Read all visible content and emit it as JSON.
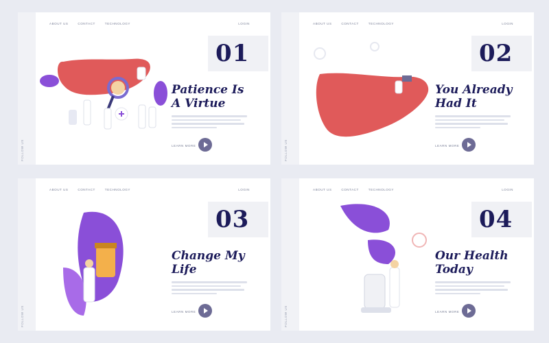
{
  "cards": [
    {
      "number": "01",
      "title_line1": "Patience Is",
      "title_line2": "A Virtue"
    },
    {
      "number": "02",
      "title_line1": "You Already",
      "title_line2": "Had It"
    },
    {
      "number": "03",
      "title_line1": "Change My",
      "title_line2": "Life"
    },
    {
      "number": "04",
      "title_line1": "Our Health",
      "title_line2": "Today"
    }
  ],
  "nav": {
    "about": "ABOUT US",
    "contact": "CONTACT",
    "technology": "TECHNOLOGY",
    "login": "LOGIN"
  },
  "follow_us": "FOLLOW US",
  "learn_more": "LEARN MORE",
  "colors": {
    "navy": "#1c1b5a",
    "liver": "#e05a5a",
    "leaf": "#8a4fd8",
    "play": "#6d6b95"
  }
}
